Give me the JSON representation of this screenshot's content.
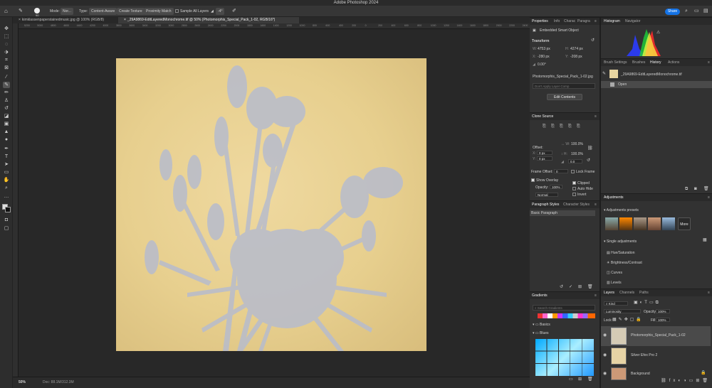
{
  "app": {
    "title": "Adobe Photoshop 2024"
  },
  "options_bar": {
    "brush_size": "90",
    "mode_label": "Mode:",
    "mode_value": "Nor...",
    "type_label": "Type:",
    "type_options": [
      "Content-Aware",
      "Create Texture",
      "Proximity Match"
    ],
    "sample_all_layers": "Sample All Layers",
    "angle": "-4°",
    "share": "Share"
  },
  "doc_tabs": [
    {
      "label": "kimklassenpaperstainedmusic.jpg @ 100% (RGB/8)",
      "active": false
    },
    {
      "label": "_29A9869-EditLayeredMonochrome.tif @ 50% (Photomorphis_Special_Pack_1-02, RGB/16*)",
      "active": true
    }
  ],
  "ruler_ticks": [
    "5200",
    "5000",
    "4800",
    "4600",
    "4400",
    "4200",
    "4000",
    "3800",
    "3600",
    "3400",
    "3200",
    "3000",
    "2800",
    "2600",
    "2400",
    "2200",
    "2000",
    "1800",
    "1600",
    "1400",
    "1200",
    "1000",
    "800",
    "600",
    "400",
    "200",
    "0",
    "200",
    "400",
    "600",
    "800",
    "1000",
    "1200",
    "1400",
    "1600",
    "1800",
    "2000",
    "2200",
    "2400"
  ],
  "status": {
    "zoom": "50%",
    "doc_info": "Doc: 88.1M/312.3M"
  },
  "properties": {
    "tabs": [
      "Properties",
      "Info",
      "Charac",
      "Paragra"
    ],
    "object_type": "Embedded Smart Object",
    "transform_label": "Transform",
    "w": "4753 px",
    "h": "4274 px",
    "x": "-280 px",
    "y": "-208 px",
    "angle": "0.00°",
    "linked_file": "Photomorphis_Special_Pack_1-02.jpg",
    "layer_comp_placeholder": "Don't Apply Layer Comp",
    "edit_contents": "Edit Contents"
  },
  "clone_source": {
    "title": "Clone Source",
    "offset_label": "Offset:",
    "offset_x": "0 px",
    "offset_y": "0 px",
    "w_pct": "100.0%",
    "h_pct": "100.0%",
    "angle": "0.0",
    "frame_offset_label": "Frame Offset:",
    "frame_offset": "0",
    "lock_frame": "Lock Frame",
    "show_overlay": "Show Overlay",
    "opacity_label": "Opacity:",
    "opacity": "100%",
    "blend": "Normal",
    "clipped": "Clipped",
    "auto_hide": "Auto Hide",
    "invert": "Invert"
  },
  "paragraph_styles": {
    "tabs": [
      "Paragraph Styles",
      "Character Styles"
    ],
    "items": [
      "Basic Paragraph"
    ]
  },
  "gradients": {
    "title": "Gradients",
    "search_placeholder": "Search Gradients",
    "groups": [
      "Basics",
      "Blues"
    ]
  },
  "histogram": {
    "tabs": [
      "Histogram",
      "Navigator"
    ]
  },
  "history": {
    "tabs": [
      "Brush Settings",
      "Brushes",
      "History",
      "Actions"
    ],
    "snapshot": "_29A9869-EditLayeredMonochrome.tif",
    "states": [
      "Open"
    ]
  },
  "adjustments": {
    "title": "Adjustments",
    "presets_label": "Adjustments presets",
    "more": "More",
    "single_label": "Single adjustments",
    "items": [
      "Hue/Saturation",
      "Brightness/Contrast",
      "Curves",
      "Levels"
    ]
  },
  "layers": {
    "tabs": [
      "Layers",
      "Channels",
      "Paths"
    ],
    "kind": "Kind",
    "blend_mode": "Luminosity",
    "opacity_label": "Opacity:",
    "opacity": "100%",
    "lock_label": "Lock:",
    "fill_label": "Fill:",
    "fill": "100%",
    "items": [
      {
        "name": "Photomorphis_Special_Pack_1-02",
        "selected": true
      },
      {
        "name": "Silver Efex Pro 2",
        "selected": false
      },
      {
        "name": "Background",
        "selected": false
      }
    ]
  }
}
